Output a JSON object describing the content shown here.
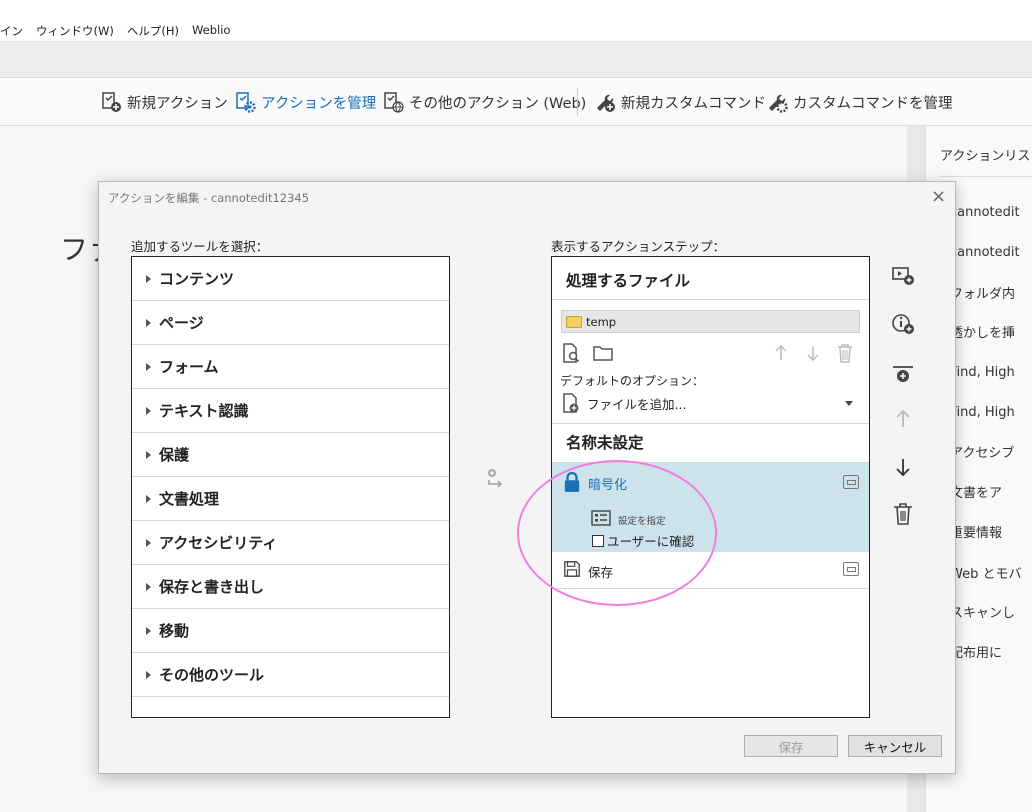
{
  "menu": [
    "イン",
    "ウィンドウ(W)",
    "ヘルプ(H)",
    "Weblio"
  ],
  "toolbar": {
    "new_action": "新規アクション",
    "manage_actions": "アクションを管理",
    "other_actions": "その他のアクション (Web)",
    "new_custom_command": "新規カスタムコマンド",
    "manage_custom_commands": "カスタムコマンドを管理"
  },
  "background_title": "ファ",
  "right_panel": {
    "header": "アクションリスト",
    "items": [
      "cannotedit",
      "cannotedit",
      "フォルダ内",
      "透かしを挿",
      "Find, High",
      "Find, High",
      "アクセシブ",
      "文書をア",
      "重要情報",
      "Web とモバ",
      "スキャンし",
      "配布用に"
    ]
  },
  "dialog": {
    "title": "アクションを編集 - cannotedit12345",
    "close": "×",
    "left_label": "追加するツールを選択：",
    "right_label": "表示するアクションステップ：",
    "tools": [
      "コンテンツ",
      "ページ",
      "フォーム",
      "テキスト認識",
      "保護",
      "文書処理",
      "アクセシビリティ",
      "保存と書き出し",
      "移動",
      "その他のツール"
    ],
    "files_header": "処理するファイル",
    "folder_name": "temp",
    "default_options_label": "デフォルトのオプション：",
    "add_files": "ファイルを追加...",
    "untitled_header": "名称未設定",
    "step_encrypt": "暗号化",
    "step_specify_settings": "設定を指定",
    "confirm_with_user": "ユーザーに確認",
    "step_save": "保存",
    "save_button": "保存",
    "cancel_button": "キャンセル"
  },
  "colors": {
    "accent": "#1a6fb8",
    "selected_row": "#cde3ec",
    "annotation": "#f07ee0"
  }
}
